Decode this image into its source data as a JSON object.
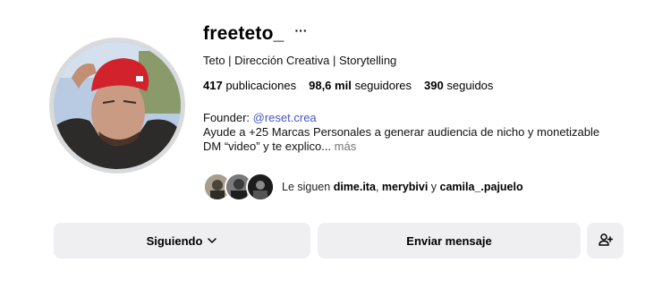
{
  "profile": {
    "username": "freeteto_",
    "subtitle": "Teto | Dirección Creativa | Storytelling",
    "stats": {
      "posts_count": "417",
      "posts_label": "publicaciones",
      "followers_count": "98,6 mil",
      "followers_label": "seguidores",
      "following_count": "390",
      "following_label": "seguidos"
    },
    "bio": {
      "founder_label": "Founder: ",
      "founder_link": "@reset.crea",
      "line2": "Ayude a +25 Marcas Personales a generar audiencia de nicho y monetizable",
      "line3": "DM “video” y te explico...",
      "more_label": "más"
    },
    "followed_by": {
      "prefix": "Le siguen ",
      "user1": "dime.ita",
      "separator1": ", ",
      "user2": "merybivi",
      "separator2": " y ",
      "user3": "camila_.pajuelo"
    }
  },
  "actions": {
    "following_label": "Siguiendo",
    "message_label": "Enviar mensaje"
  },
  "icons": {
    "more": "more-options-icon",
    "chevron": "chevron-down-icon",
    "add_person": "add-person-icon"
  },
  "colors": {
    "link": "#4755c4",
    "button_bg": "#efeff2",
    "muted": "#737373"
  }
}
